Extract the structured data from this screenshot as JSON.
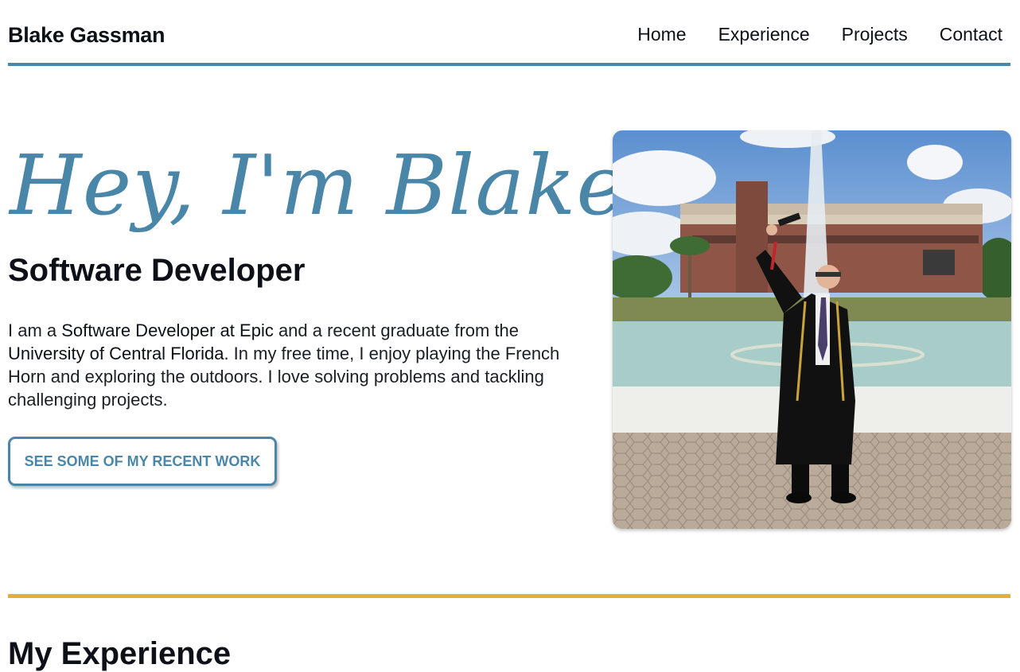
{
  "header": {
    "brand": "Blake Gassman",
    "links": [
      "Home",
      "Experience",
      "Projects",
      "Contact"
    ]
  },
  "hero": {
    "title": "Hey, I'm Blake",
    "subtitle": "Software Developer",
    "bio": {
      "p1": "I am a ",
      "b1": "Software Developer at Epic",
      "p2": " and a recent graduate from the ",
      "b2": "University of Central Florida",
      "p3": ". In my free time, I enjoy playing the French Horn and exploring the outdoors. I love solving problems and tackling challenging projects."
    },
    "cta_label": "SEE SOME OF MY RECENT WORK",
    "photo_alt": "graduation photo in front of fountain"
  },
  "experience": {
    "title": "My Experience"
  },
  "colors": {
    "accent": "#4a86a8",
    "divider": "#e4ae3c",
    "text": "#0d1117"
  }
}
